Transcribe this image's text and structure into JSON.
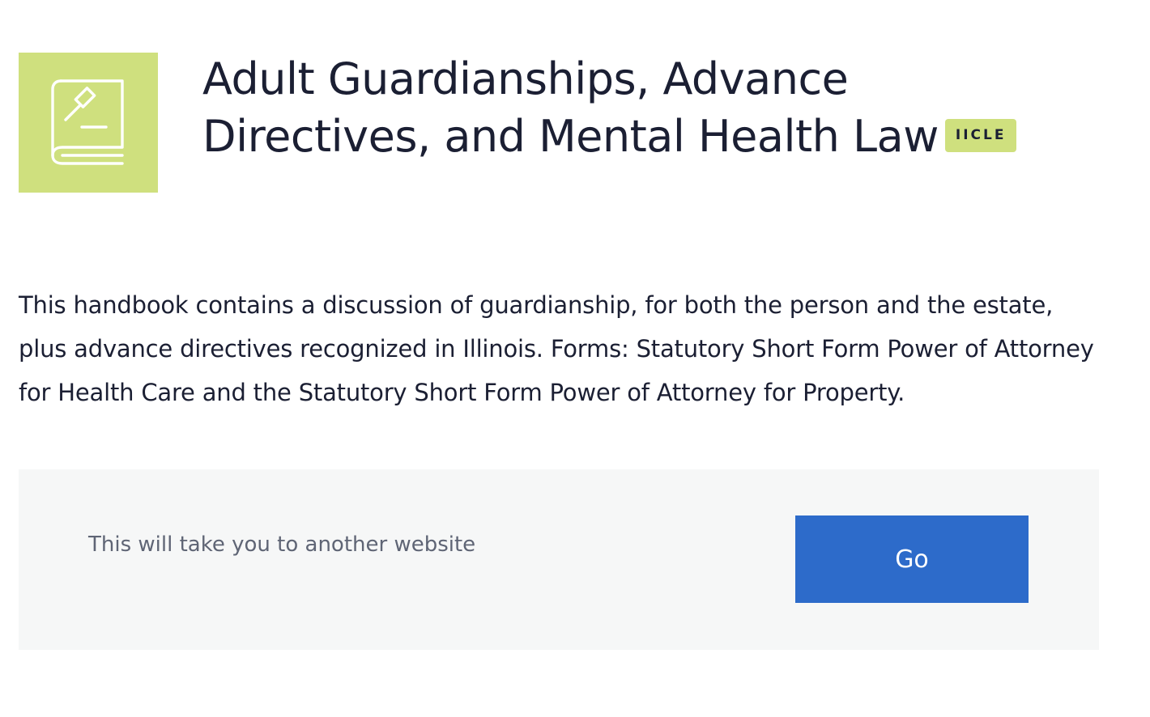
{
  "colors": {
    "icon_tile_bg": "#cfe07e",
    "badge_bg": "#cfe07e",
    "panel_bg": "#f6f7f7",
    "button_bg": "#2d6bca",
    "title_text": "#1b1f33"
  },
  "header": {
    "icon": "gavel-book-icon",
    "title": "Adult Guardianships, Advance Directives, and Mental Health Law",
    "badge": "IICLE"
  },
  "description": "This handbook contains a discussion of guardianship, for both the person and the estate, plus advance directives recognized in Illinois. Forms: Statutory Short Form Power of Attorney for Health Care and the Statutory Short Form Power of Attorney for Property.",
  "redirect": {
    "notice": "This will take you to another website",
    "button_label": "Go"
  }
}
